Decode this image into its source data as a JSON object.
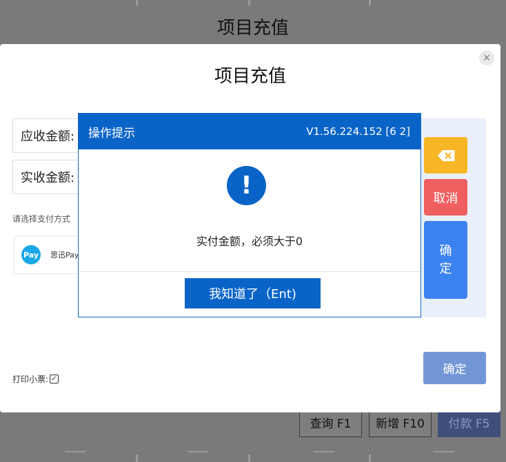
{
  "background": {
    "title": "项目充值",
    "buttons": {
      "query": "查询 F1",
      "add": "新增 F10",
      "pay": "付款 F5"
    }
  },
  "dialog": {
    "title": "项目充值",
    "close_icon": "×",
    "fields": {
      "receivable_label": "应收金额:",
      "received_label": "实收金额:"
    },
    "payment_hint": "请选择支付方式",
    "payment_option": {
      "logo_text": "Pay",
      "name": "思迅Pay"
    },
    "keypad": {
      "delete_icon": "backspace-icon",
      "cancel": "取消",
      "confirm": "确定"
    },
    "print_receipt_label": "打印小票:",
    "print_receipt_checked": true,
    "print_check_glyph": "✓",
    "confirm_button": "确定"
  },
  "alert": {
    "title": "操作提示",
    "version": "V1.56.224.152 [6      2]",
    "icon_glyph": "!",
    "icon": "exclamation-circle-icon",
    "message": "实付金额，必须大于0",
    "button": "我知道了（Ent)"
  },
  "colors": {
    "primary_blue": "#0a64c8",
    "keypad_delete": "#f7b626",
    "keypad_cancel": "#f05f5f",
    "keypad_confirm": "#3c82f0",
    "confirm_button": "#7397d6",
    "pay_logo": "#1aa7e8"
  }
}
